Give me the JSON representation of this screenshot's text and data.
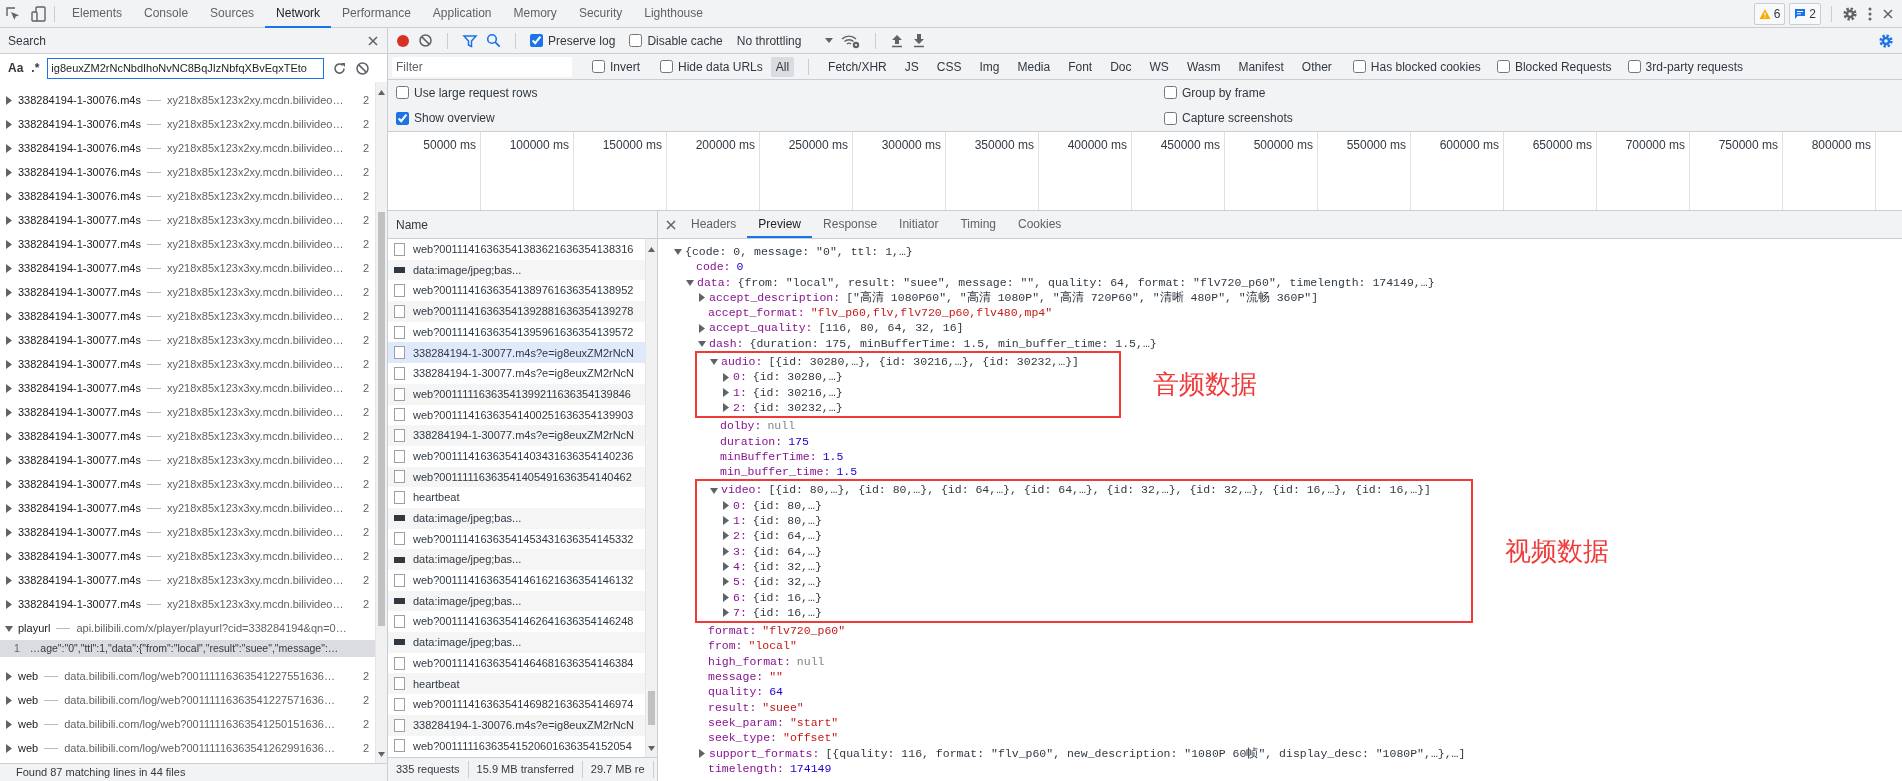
{
  "devtools_tabs": [
    {
      "label": "Elements",
      "selected": false
    },
    {
      "label": "Console",
      "selected": false
    },
    {
      "label": "Sources",
      "selected": false
    },
    {
      "label": "Network",
      "selected": true
    },
    {
      "label": "Performance",
      "selected": false
    },
    {
      "label": "Application",
      "selected": false
    },
    {
      "label": "Memory",
      "selected": false
    },
    {
      "label": "Security",
      "selected": false
    },
    {
      "label": "Lighthouse",
      "selected": false
    }
  ],
  "issue_counts": {
    "warnings": "6",
    "messages": "2"
  },
  "search_panel": {
    "title": "Search",
    "case_toggle": "Aa",
    "regex_toggle": ".*",
    "query": "ig8euxZM2rNcNbdIhoNvNC8BqJIzNbfqXBvEqxTEto",
    "results": [
      {
        "file": "338284194-1-30076.m4s",
        "url": "xy218x85x123x2xy.mcdn.bilivideo…",
        "count": "2",
        "expanded": false
      },
      {
        "file": "338284194-1-30076.m4s",
        "url": "xy218x85x123x2xy.mcdn.bilivideo…",
        "count": "2",
        "expanded": false
      },
      {
        "file": "338284194-1-30076.m4s",
        "url": "xy218x85x123x2xy.mcdn.bilivideo…",
        "count": "2",
        "expanded": false
      },
      {
        "file": "338284194-1-30076.m4s",
        "url": "xy218x85x123x2xy.mcdn.bilivideo…",
        "count": "2",
        "expanded": false
      },
      {
        "file": "338284194-1-30076.m4s",
        "url": "xy218x85x123x2xy.mcdn.bilivideo…",
        "count": "2",
        "expanded": false
      },
      {
        "file": "338284194-1-30077.m4s",
        "url": "xy218x85x123x3xy.mcdn.bilivideo…",
        "count": "2",
        "expanded": false
      },
      {
        "file": "338284194-1-30077.m4s",
        "url": "xy218x85x123x3xy.mcdn.bilivideo…",
        "count": "2",
        "expanded": false
      },
      {
        "file": "338284194-1-30077.m4s",
        "url": "xy218x85x123x3xy.mcdn.bilivideo…",
        "count": "2",
        "expanded": false
      },
      {
        "file": "338284194-1-30077.m4s",
        "url": "xy218x85x123x3xy.mcdn.bilivideo…",
        "count": "2",
        "expanded": false
      },
      {
        "file": "338284194-1-30077.m4s",
        "url": "xy218x85x123x3xy.mcdn.bilivideo…",
        "count": "2",
        "expanded": false
      },
      {
        "file": "338284194-1-30077.m4s",
        "url": "xy218x85x123x3xy.mcdn.bilivideo…",
        "count": "2",
        "expanded": false
      },
      {
        "file": "338284194-1-30077.m4s",
        "url": "xy218x85x123x3xy.mcdn.bilivideo…",
        "count": "2",
        "expanded": false
      },
      {
        "file": "338284194-1-30077.m4s",
        "url": "xy218x85x123x3xy.mcdn.bilivideo…",
        "count": "2",
        "expanded": false
      },
      {
        "file": "338284194-1-30077.m4s",
        "url": "xy218x85x123x3xy.mcdn.bilivideo…",
        "count": "2",
        "expanded": false
      },
      {
        "file": "338284194-1-30077.m4s",
        "url": "xy218x85x123x3xy.mcdn.bilivideo…",
        "count": "2",
        "expanded": false
      },
      {
        "file": "338284194-1-30077.m4s",
        "url": "xy218x85x123x3xy.mcdn.bilivideo…",
        "count": "2",
        "expanded": false
      },
      {
        "file": "338284194-1-30077.m4s",
        "url": "xy218x85x123x3xy.mcdn.bilivideo…",
        "count": "2",
        "expanded": false
      },
      {
        "file": "338284194-1-30077.m4s",
        "url": "xy218x85x123x3xy.mcdn.bilivideo…",
        "count": "2",
        "expanded": false
      },
      {
        "file": "338284194-1-30077.m4s",
        "url": "xy218x85x123x3xy.mcdn.bilivideo…",
        "count": "2",
        "expanded": false
      },
      {
        "file": "338284194-1-30077.m4s",
        "url": "xy218x85x123x3xy.mcdn.bilivideo…",
        "count": "2",
        "expanded": false
      },
      {
        "file": "338284194-1-30077.m4s",
        "url": "xy218x85x123x3xy.mcdn.bilivideo…",
        "count": "2",
        "expanded": false
      },
      {
        "file": "338284194-1-30077.m4s",
        "url": "xy218x85x123x3xy.mcdn.bilivideo…",
        "count": "2",
        "expanded": false
      },
      {
        "file": "playurl",
        "url": "api.bilibili.com/x/player/playurl?cid=338284194&qn=0…",
        "expanded": true,
        "matches": [
          {
            "line": "1",
            "text": "…age\":\"0\",\"ttl\":1,\"data\":{\"from\":\"local\",\"result\":\"suee\",\"message\":…"
          }
        ]
      },
      {
        "file": "web",
        "url": "data.bilibili.com/log/web?00111116363541227551636…",
        "count": "2",
        "expanded": false
      },
      {
        "file": "web",
        "url": "data.bilibili.com/log/web?00111116363541227571636…",
        "count": "2",
        "expanded": false
      },
      {
        "file": "web",
        "url": "data.bilibili.com/log/web?00111116363541250151636…",
        "count": "2",
        "expanded": false
      },
      {
        "file": "web",
        "url": "data.bilibili.com/log/web?00111116363541262991636…",
        "count": "2",
        "expanded": false
      }
    ],
    "summary": "Found 87 matching lines in 44 files"
  },
  "network_toolbar": {
    "recording": true,
    "filter_active": true,
    "checkboxes": [
      {
        "label": "Preserve log",
        "checked": true
      },
      {
        "label": "Disable cache",
        "checked": false
      }
    ],
    "throttling": "No throttling"
  },
  "filter_bar": {
    "placeholder": "Filter",
    "options": [
      {
        "label": "Invert",
        "checked": false
      },
      {
        "label": "Hide data URLs",
        "checked": false
      }
    ],
    "types": [
      {
        "label": "All",
        "selected": true
      },
      {
        "label": "Fetch/XHR",
        "selected": false
      },
      {
        "label": "JS",
        "selected": false
      },
      {
        "label": "CSS",
        "selected": false
      },
      {
        "label": "Img",
        "selected": false
      },
      {
        "label": "Media",
        "selected": false
      },
      {
        "label": "Font",
        "selected": false
      },
      {
        "label": "Doc",
        "selected": false
      },
      {
        "label": "WS",
        "selected": false
      },
      {
        "label": "Wasm",
        "selected": false
      },
      {
        "label": "Manifest",
        "selected": false
      },
      {
        "label": "Other",
        "selected": false
      }
    ],
    "extra_options": [
      {
        "label": "Has blocked cookies",
        "checked": false
      },
      {
        "label": "Blocked Requests",
        "checked": false
      },
      {
        "label": "3rd-party requests",
        "checked": false
      }
    ]
  },
  "settings": {
    "left": [
      {
        "label": "Use large request rows",
        "checked": false
      },
      {
        "label": "Show overview",
        "checked": true
      }
    ],
    "right": [
      {
        "label": "Group by frame",
        "checked": false
      },
      {
        "label": "Capture screenshots",
        "checked": false
      }
    ]
  },
  "overview": {
    "ticks": [
      "50000 ms",
      "100000 ms",
      "150000 ms",
      "200000 ms",
      "250000 ms",
      "300000 ms",
      "350000 ms",
      "400000 ms",
      "450000 ms",
      "500000 ms",
      "550000 ms",
      "600000 ms",
      "650000 ms",
      "700000 ms",
      "750000 ms",
      "800000 ms"
    ]
  },
  "requests": {
    "column": "Name",
    "rows": [
      {
        "name": "web?00111416363541383621636354138316",
        "kind": "doc",
        "highlighted": false
      },
      {
        "name": "data:image/jpeg;bas...",
        "kind": "image",
        "highlighted": false
      },
      {
        "name": "web?00111416363541389761636354138952",
        "kind": "doc",
        "highlighted": false
      },
      {
        "name": "web?00111416363541392881636354139278",
        "kind": "doc",
        "highlighted": false
      },
      {
        "name": "web?00111416363541395961636354139572",
        "kind": "doc",
        "highlighted": false
      },
      {
        "name": "338284194-1-30077.m4s?e=ig8euxZM2rNcN",
        "kind": "doc",
        "highlighted": true
      },
      {
        "name": "338284194-1-30077.m4s?e=ig8euxZM2rNcN",
        "kind": "doc",
        "highlighted": false
      },
      {
        "name": "web?00111116363541399211636354139846",
        "kind": "doc",
        "highlighted": false
      },
      {
        "name": "web?00111416363541400251636354139903",
        "kind": "doc",
        "highlighted": false
      },
      {
        "name": "338284194-1-30077.m4s?e=ig8euxZM2rNcN",
        "kind": "doc",
        "highlighted": false
      },
      {
        "name": "web?00111416363541403431636354140236",
        "kind": "doc",
        "highlighted": false
      },
      {
        "name": "web?00111116363541405491636354140462",
        "kind": "doc",
        "highlighted": false
      },
      {
        "name": "heartbeat",
        "kind": "doc",
        "highlighted": false
      },
      {
        "name": "data:image/jpeg;bas...",
        "kind": "image",
        "highlighted": false
      },
      {
        "name": "web?00111416363541453431636354145332",
        "kind": "doc",
        "highlighted": false
      },
      {
        "name": "data:image/jpeg;bas...",
        "kind": "image",
        "highlighted": false
      },
      {
        "name": "web?00111416363541461621636354146132",
        "kind": "doc",
        "highlighted": false
      },
      {
        "name": "data:image/jpeg;bas...",
        "kind": "image",
        "highlighted": false
      },
      {
        "name": "web?00111416363541462641636354146248",
        "kind": "doc",
        "highlighted": false
      },
      {
        "name": "data:image/jpeg;bas...",
        "kind": "image",
        "highlighted": false
      },
      {
        "name": "web?00111416363541464681636354146384",
        "kind": "doc",
        "highlighted": false
      },
      {
        "name": "heartbeat",
        "kind": "doc",
        "highlighted": false
      },
      {
        "name": "web?00111416363541469821636354146974",
        "kind": "doc",
        "highlighted": false
      },
      {
        "name": "338284194-1-30076.m4s?e=ig8euxZM2rNcN",
        "kind": "doc",
        "highlighted": false
      },
      {
        "name": "web?00111116363541520601636354152054",
        "kind": "doc",
        "highlighted": false
      }
    ],
    "status": [
      "335 requests",
      "15.9 MB transferred",
      "29.7 MB re"
    ]
  },
  "details": {
    "tabs": [
      {
        "label": "Headers",
        "selected": false
      },
      {
        "label": "Preview",
        "selected": true
      },
      {
        "label": "Response",
        "selected": false
      },
      {
        "label": "Initiator",
        "selected": false
      },
      {
        "label": "Timing",
        "selected": false
      },
      {
        "label": "Cookies",
        "selected": false
      }
    ],
    "preview": [
      {
        "value": "{code: 0, message: \"0\", ttl: 1,…}",
        "kind": "object",
        "expanded": true,
        "children": [
          {
            "key": "code:",
            "value": "0",
            "kind": "number"
          },
          {
            "key": "data:",
            "value": "{from: \"local\", result: \"suee\", message: \"\", quality: 64, format: \"flv720_p60\", timelength: 174149,…}",
            "kind": "object",
            "expanded": true,
            "children": [
              {
                "key": "accept_description:",
                "value": "[\"高清 1080P60\", \"高清 1080P\", \"高清 720P60\", \"清晰 480P\", \"流畅 360P\"]",
                "kind": "object",
                "expanded": false
              },
              {
                "key": "accept_format:",
                "value": "\"flv_p60,flv,flv720_p60,flv480,mp4\"",
                "kind": "string"
              },
              {
                "key": "accept_quality:",
                "value": "[116, 80, 64, 32, 16]",
                "kind": "object",
                "expanded": false
              },
              {
                "key": "dash:",
                "value": "{duration: 175, minBufferTime: 1.5, min_buffer_time: 1.5,…}",
                "kind": "object",
                "expanded": true,
                "children": [
                  {
                    "key": "audio:",
                    "value": "[{id: 30280,…}, {id: 30216,…}, {id: 30232,…}]",
                    "kind": "object",
                    "expanded": true,
                    "annotation": "音频数据",
                    "children": [
                      {
                        "key": "0:",
                        "value": "{id: 30280,…}",
                        "kind": "object",
                        "expanded": false
                      },
                      {
                        "key": "1:",
                        "value": "{id: 30216,…}",
                        "kind": "object",
                        "expanded": false
                      },
                      {
                        "key": "2:",
                        "value": "{id: 30232,…}",
                        "kind": "object",
                        "expanded": false
                      }
                    ]
                  },
                  {
                    "key": "dolby:",
                    "value": "null",
                    "kind": "null"
                  },
                  {
                    "key": "duration:",
                    "value": "175",
                    "kind": "number"
                  },
                  {
                    "key": "minBufferTime:",
                    "value": "1.5",
                    "kind": "number"
                  },
                  {
                    "key": "min_buffer_time:",
                    "value": "1.5",
                    "kind": "number"
                  },
                  {
                    "key": "video:",
                    "value": "[{id: 80,…}, {id: 80,…}, {id: 64,…}, {id: 64,…}, {id: 32,…}, {id: 32,…}, {id: 16,…}, {id: 16,…}]",
                    "kind": "object",
                    "expanded": true,
                    "annotation": "视频数据",
                    "children": [
                      {
                        "key": "0:",
                        "value": "{id: 80,…}",
                        "kind": "object",
                        "expanded": false
                      },
                      {
                        "key": "1:",
                        "value": "{id: 80,…}",
                        "kind": "object",
                        "expanded": false
                      },
                      {
                        "key": "2:",
                        "value": "{id: 64,…}",
                        "kind": "object",
                        "expanded": false
                      },
                      {
                        "key": "3:",
                        "value": "{id: 64,…}",
                        "kind": "object",
                        "expanded": false
                      },
                      {
                        "key": "4:",
                        "value": "{id: 32,…}",
                        "kind": "object",
                        "expanded": false
                      },
                      {
                        "key": "5:",
                        "value": "{id: 32,…}",
                        "kind": "object",
                        "expanded": false
                      },
                      {
                        "key": "6:",
                        "value": "{id: 16,…}",
                        "kind": "object",
                        "expanded": false
                      },
                      {
                        "key": "7:",
                        "value": "{id: 16,…}",
                        "kind": "object",
                        "expanded": false
                      }
                    ]
                  }
                ]
              },
              {
                "key": "format:",
                "value": "\"flv720_p60\"",
                "kind": "string"
              },
              {
                "key": "from:",
                "value": "\"local\"",
                "kind": "string"
              },
              {
                "key": "high_format:",
                "value": "null",
                "kind": "null"
              },
              {
                "key": "message:",
                "value": "\"\"",
                "kind": "string"
              },
              {
                "key": "quality:",
                "value": "64",
                "kind": "number"
              },
              {
                "key": "result:",
                "value": "\"suee\"",
                "kind": "string"
              },
              {
                "key": "seek_param:",
                "value": "\"start\"",
                "kind": "string"
              },
              {
                "key": "seek_type:",
                "value": "\"offset\"",
                "kind": "string"
              },
              {
                "key": "support_formats:",
                "value": "[{quality: 116, format: \"flv_p60\", new_description: \"1080P 60帧\", display_desc: \"1080P\",…},…]",
                "kind": "object",
                "expanded": false
              },
              {
                "key": "timelength:",
                "value": "174149",
                "kind": "number"
              }
            ]
          }
        ]
      }
    ]
  }
}
